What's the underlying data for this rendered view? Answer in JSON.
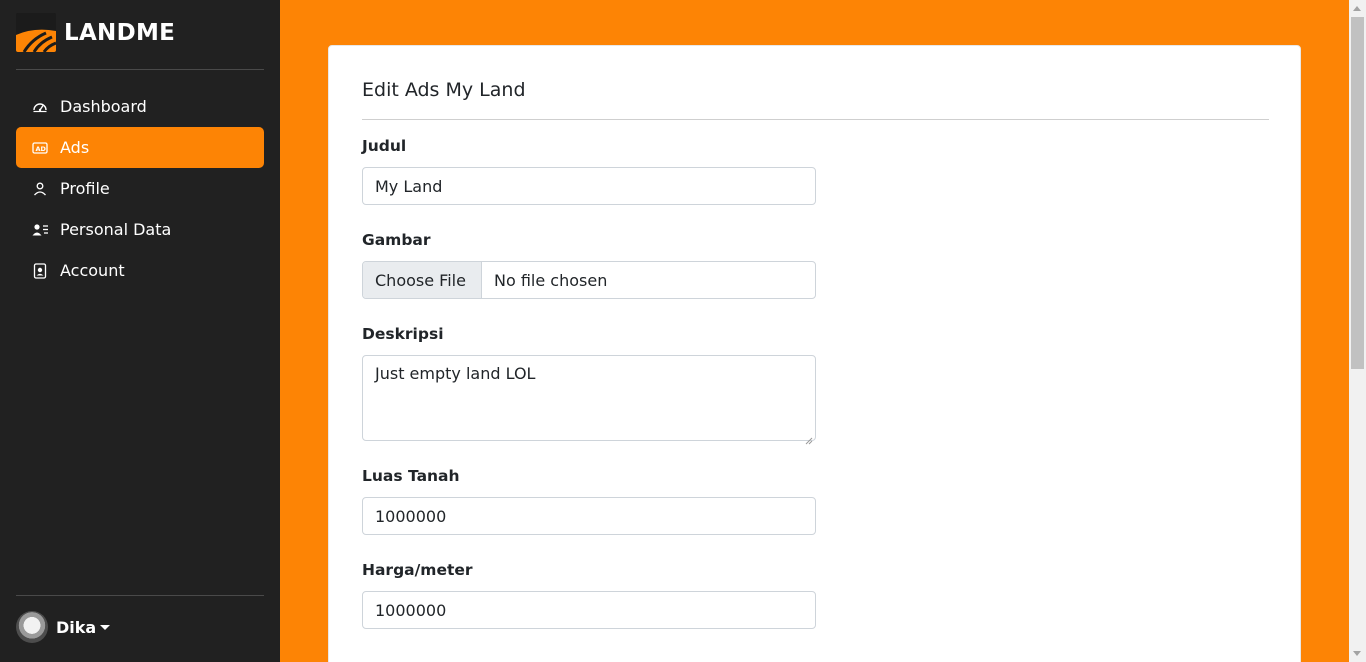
{
  "brand": {
    "name": "LANDME"
  },
  "sidebar": {
    "items": [
      {
        "label": "Dashboard",
        "icon": "speedometer-icon"
      },
      {
        "label": "Ads",
        "icon": "ad-icon",
        "active": true
      },
      {
        "label": "Profile",
        "icon": "person-icon"
      },
      {
        "label": "Personal Data",
        "icon": "person-lines-icon"
      },
      {
        "label": "Account",
        "icon": "person-badge-icon"
      }
    ]
  },
  "user": {
    "name": "Dika"
  },
  "form": {
    "title": "Edit Ads My Land",
    "judul": {
      "label": "Judul",
      "value": "My Land"
    },
    "gambar": {
      "label": "Gambar",
      "button": "Choose File",
      "status": "No file chosen"
    },
    "deskripsi": {
      "label": "Deskripsi",
      "value": "Just empty land LOL"
    },
    "luas": {
      "label": "Luas Tanah",
      "value": "1000000"
    },
    "harga": {
      "label": "Harga/meter",
      "value": "1000000"
    }
  },
  "colors": {
    "accent": "#fd8405",
    "sidebar": "#212121"
  }
}
